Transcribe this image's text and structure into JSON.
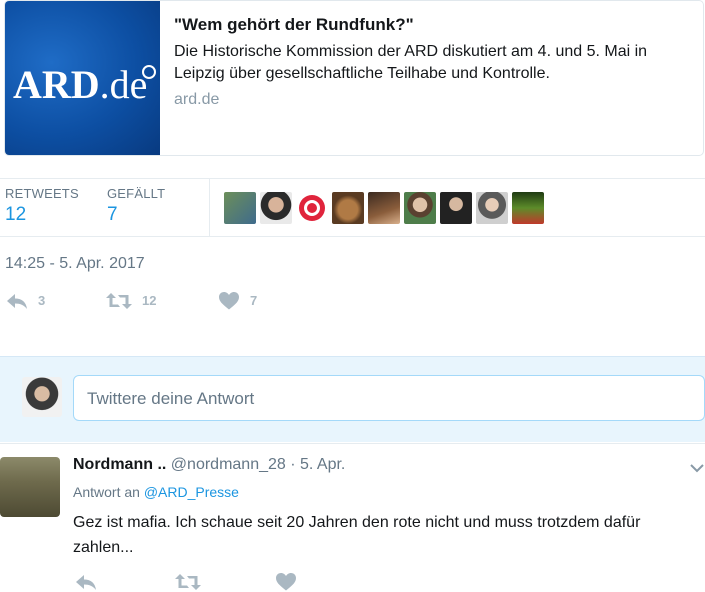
{
  "card": {
    "logo_text_main": "ARD",
    "logo_text_suffix": ".de",
    "title": "\"Wem gehört der Rundfunk?\"",
    "description": "Die Historische Kommission der ARD diskutiert am 4. und 5. Mai in Leipzig über gesellschaftliche Teilhabe und Kontrolle.",
    "domain": "ard.de"
  },
  "stats": {
    "retweets_label": "RETWEETS",
    "retweets_value": "12",
    "likes_label": "GEFÄLLT",
    "likes_value": "7",
    "avatar_count": 9
  },
  "timestamp": "14:25 - 5. Apr. 2017",
  "actions": {
    "reply_count": "3",
    "retweet_count": "12",
    "like_count": "7"
  },
  "reply_box": {
    "placeholder": "Twittere deine Antwort"
  },
  "reply_tweet": {
    "name": "Nordmann ..",
    "handle": "@nordmann_28",
    "separator": " · ",
    "date": "5. Apr.",
    "reply_to_label": "Antwort an ",
    "reply_to_handle": "@ARD_Presse",
    "text": "Gez ist mafia. Ich schaue seit 20 Jahren den rote nicht und muss trotzdem dafür zahlen..."
  },
  "colors": {
    "accent": "#1b95e0",
    "muted": "#657786",
    "icon": "#aab8c2",
    "reply_bg": "#e8f5fd",
    "ard_blue": "#0d4fa3"
  }
}
